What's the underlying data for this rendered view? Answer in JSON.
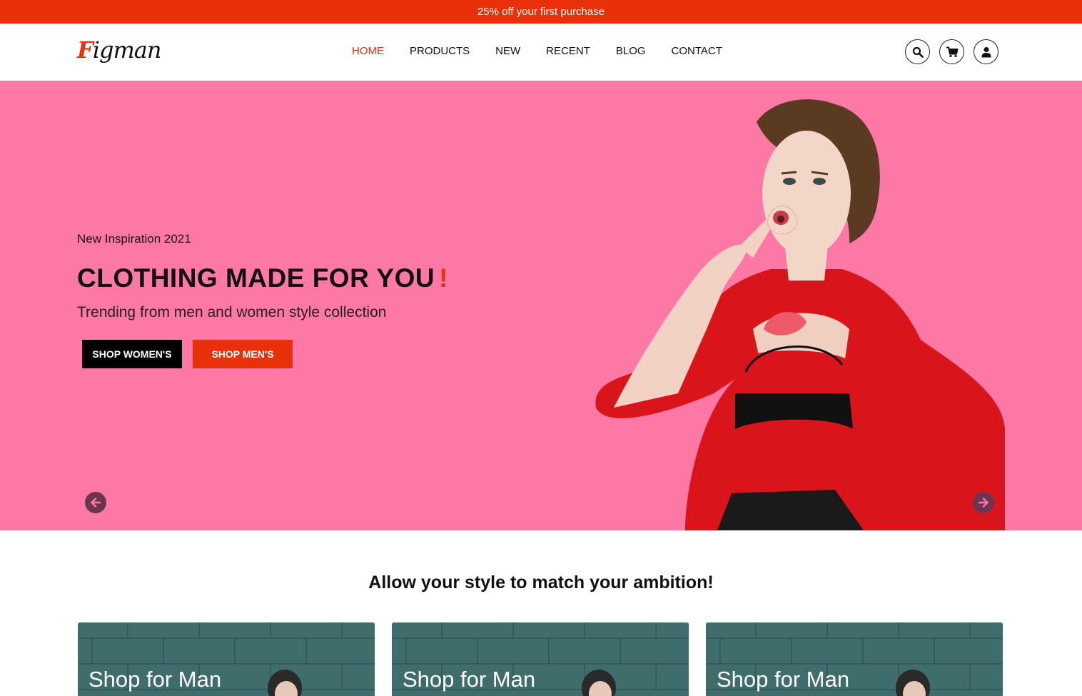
{
  "promo": {
    "text": "25% off your first purchase"
  },
  "header": {
    "logo_first": "F",
    "logo_rest": "igman",
    "nav": [
      {
        "label": "HOME",
        "active": true
      },
      {
        "label": "PRODUCTS",
        "active": false
      },
      {
        "label": "NEW",
        "active": false
      },
      {
        "label": "RECENT",
        "active": false
      },
      {
        "label": "BLOG",
        "active": false
      },
      {
        "label": "CONTACT",
        "active": false
      }
    ],
    "icons": [
      "search-icon",
      "cart-icon",
      "user-icon"
    ]
  },
  "hero": {
    "eyebrow": "New Inspiration 2021",
    "title": "CLOTHING MADE FOR YOU",
    "title_mark": "!",
    "subtitle": "Trending from men and women style collection",
    "button_women": "SHOP WOMEN'S",
    "button_men": "SHOP MEN'S",
    "prev_icon": "arrow-left-icon",
    "next_icon": "arrow-right-icon"
  },
  "section": {
    "tagline": "Allow your style to match your ambition!"
  },
  "cards": [
    {
      "title": "Shop for Man"
    },
    {
      "title": "Shop for Man"
    },
    {
      "title": "Shop for Man"
    }
  ],
  "colors": {
    "accent": "#e8300a",
    "hero_bg": "#fe78a6",
    "card_bg": "#3f6d6b",
    "text": "#111111"
  }
}
